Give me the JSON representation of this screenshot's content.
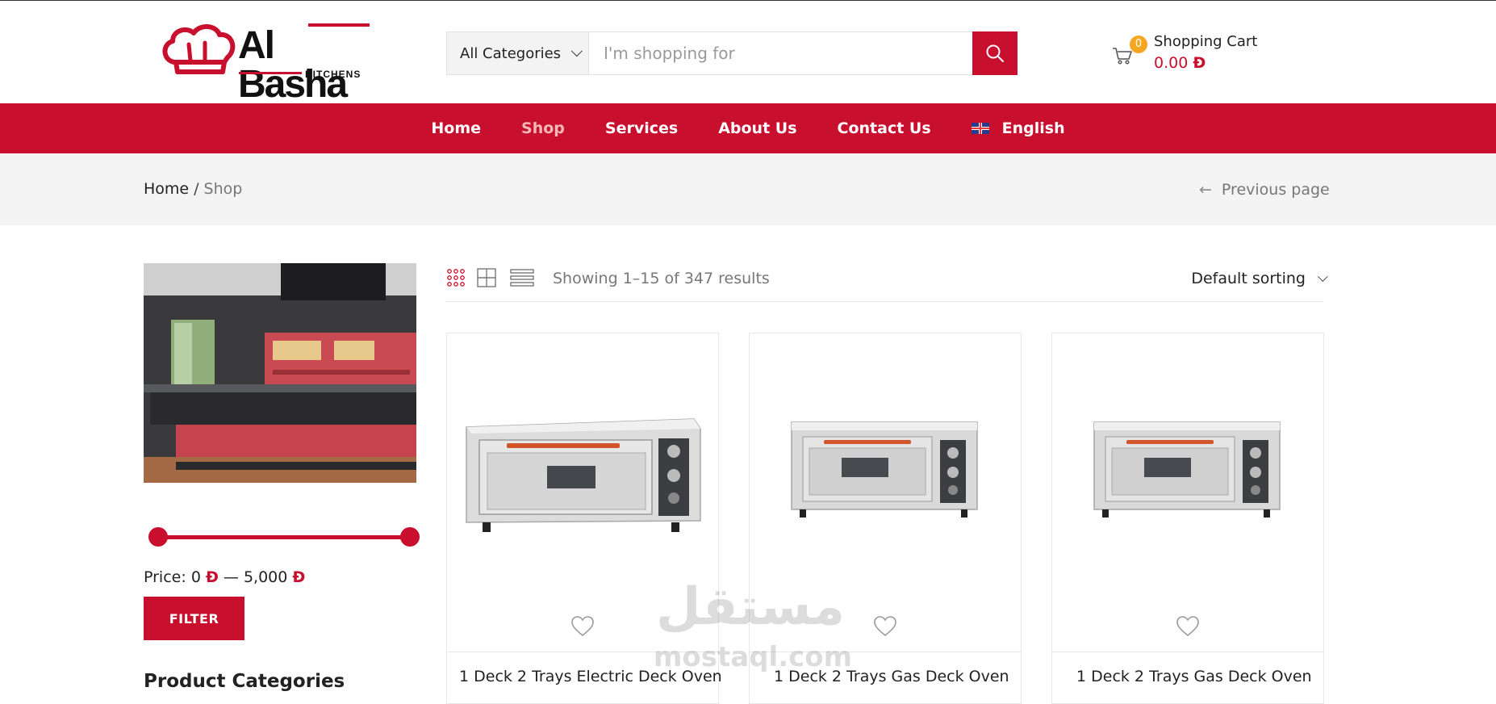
{
  "brand": {
    "name": "Al Basha",
    "sub": "KITCHENS"
  },
  "search": {
    "category": "All Categories",
    "placeholder": "I'm shopping for"
  },
  "cart": {
    "count": "0",
    "label": "Shopping Cart",
    "total": "0.00",
    "currency_symbol": "Đ"
  },
  "nav": {
    "items": [
      "Home",
      "Shop",
      "Services",
      "About Us",
      "Contact Us"
    ],
    "active": "Shop",
    "language": "English"
  },
  "breadcrumb": {
    "home": "Home",
    "separator": "/",
    "current": "Shop",
    "previous": "Previous page"
  },
  "filter": {
    "price_label": "Price:",
    "min": "0",
    "max": "5,000",
    "dash": "—",
    "currency_symbol": "Đ",
    "button": "FILTER",
    "range_min_fraction": 0,
    "range_max_fraction": 1
  },
  "sidebar": {
    "categories_title": "Product Categories"
  },
  "toolbar": {
    "views": [
      "grid-small-icon",
      "grid-large-icon",
      "list-icon"
    ],
    "results": "Showing 1–15 of 347 results",
    "sorting": "Default sorting"
  },
  "products": [
    {
      "title": "1 Deck 2 Trays Electric Deck Oven"
    },
    {
      "title": "1 Deck 2 Trays Gas Deck Oven"
    },
    {
      "title": "1 Deck 2 Trays Gas Deck Oven"
    }
  ],
  "watermark": {
    "arabic": "مستقل",
    "latin": "mostaql.com"
  },
  "colors": {
    "accent": "#c8102e",
    "badge": "#f5a623",
    "band": "#f4f4f4"
  }
}
